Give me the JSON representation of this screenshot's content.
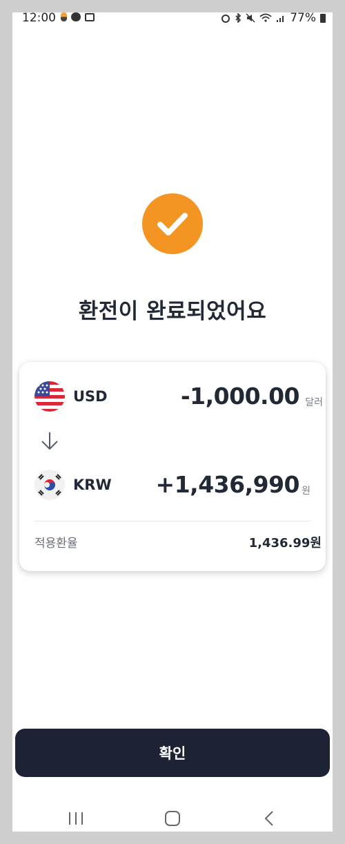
{
  "status_bar": {
    "time": "12:00",
    "battery_text": "77%"
  },
  "result": {
    "title": "환전이 완료되었어요"
  },
  "exchange": {
    "from": {
      "code": "USD",
      "amount": "-1,000.00",
      "unit": "달러"
    },
    "to": {
      "code": "KRW",
      "amount": "+1,436,990",
      "unit": "원"
    },
    "rate_label": "적용환율",
    "rate_value": "1,436.99원"
  },
  "footer": {
    "confirm_label": "확인"
  },
  "colors": {
    "accent": "#f39423",
    "primary_button": "#1d2335",
    "text_dark": "#222936"
  }
}
